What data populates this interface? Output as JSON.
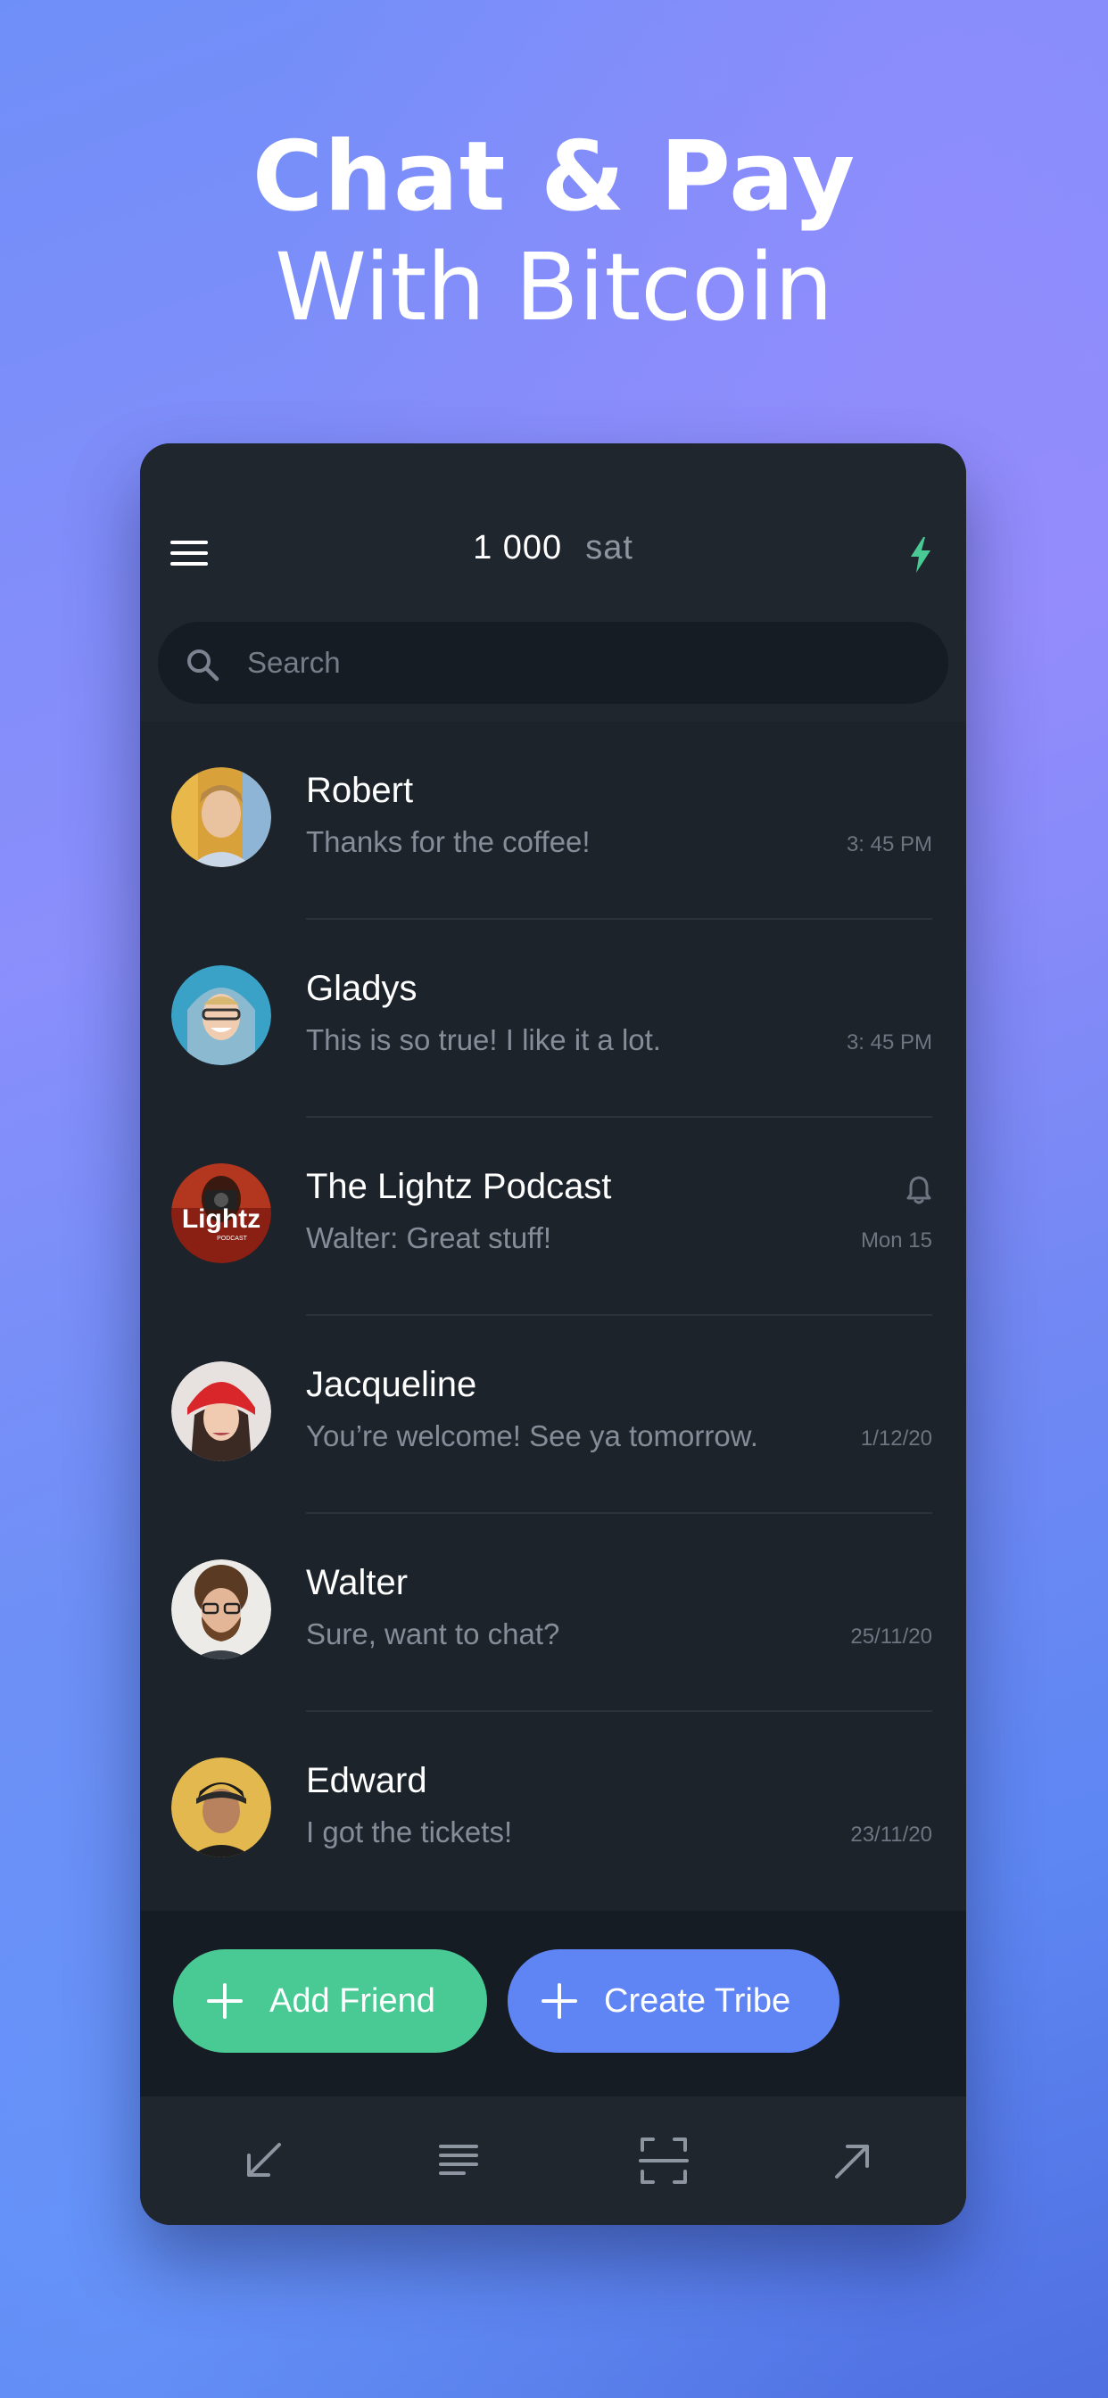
{
  "hero": {
    "title": "Chat & Pay",
    "subtitle": "With Bitcoin"
  },
  "header": {
    "balance_amount": "1 000",
    "balance_unit": "sat",
    "icons": {
      "menu": "menu-icon",
      "status": "lightning-bolt-icon"
    },
    "status_color": "#49c994"
  },
  "search": {
    "placeholder": "Search",
    "value": ""
  },
  "chats": [
    {
      "name": "Robert",
      "preview": "Thanks for the coffee!",
      "time": "3: 45 PM"
    },
    {
      "name": "Gladys",
      "preview": "This is so true! I like it a lot.",
      "time": "3: 45 PM"
    },
    {
      "name": "The Lightz Podcast",
      "preview": "Walter: Great stuff!",
      "time": "Mon 15",
      "muted_icon": "bell-icon",
      "avatar_text": "Lightz",
      "avatar_subtext": "PODCAST"
    },
    {
      "name": "Jacqueline",
      "preview": "You’re welcome! See ya tomorrow.",
      "time": "1/12/20"
    },
    {
      "name": "Walter",
      "preview": "Sure, want to chat?",
      "time": "25/11/20"
    },
    {
      "name": "Edward",
      "preview": "I got the tickets!",
      "time": "23/11/20"
    }
  ],
  "actions": {
    "add_friend": "Add Friend",
    "create_tribe": "Create Tribe",
    "add_friend_color": "#49c994",
    "create_tribe_color": "#5f84f4"
  },
  "bottom_nav": {
    "icons": [
      "receive-arrow-icon",
      "transactions-list-icon",
      "scan-qr-icon",
      "send-arrow-icon"
    ]
  },
  "colors": {
    "background_start": "#6f8ff8",
    "background_end": "#4f6fe0",
    "panel": "#1c232b"
  }
}
